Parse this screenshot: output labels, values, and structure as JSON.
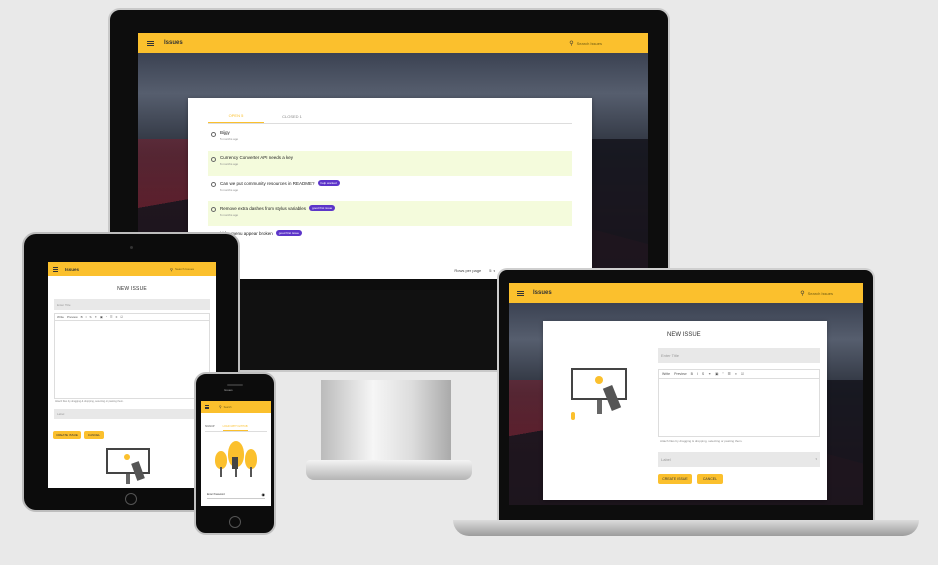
{
  "desktop": {
    "app_title": "Issues",
    "search_placeholder": "Search Issues",
    "tabs": [
      "OPEN 5",
      "CLOSED 1"
    ],
    "issues": [
      {
        "title": "Bijgy",
        "time": "5 months ago",
        "label": "",
        "highlight": false
      },
      {
        "title": "Currency Converter API needs a key",
        "time": "6 months ago",
        "label": "",
        "highlight": true
      },
      {
        "title": "Can we put community resources in README?",
        "time": "6 months ago",
        "label": "help wanted",
        "highlight": false
      },
      {
        "title": "Remove extra dashes from stylus variables",
        "time": "6 months ago",
        "label": "good first issue",
        "highlight": true
      },
      {
        "title": "ld for menu appear broken",
        "time": "",
        "label": "good first issue",
        "highlight": false
      }
    ],
    "pagination": {
      "rows_label": "Rows per page",
      "rows_value": "5",
      "range": "1-5 of 6"
    }
  },
  "tablet": {
    "app_title": "Issues",
    "search_placeholder": "Search Issues",
    "form_title": "NEW ISSUE",
    "title_placeholder": "Enter Title",
    "toolbar": [
      "Write",
      "Preview",
      "B",
      "I",
      "S",
      "⚭",
      "▣",
      "”",
      "☰",
      "≡",
      "☑"
    ],
    "hint": "Attach files by dragging & dropping, selecting or pasting them.",
    "label_placeholder": "Label",
    "create_label": "CREATE ISSUE",
    "cancel_label": "CANCEL"
  },
  "phone": {
    "status": "Issues",
    "search_placeholder": "Search",
    "tabs": [
      "SIGNUP",
      "LOGIN WITH GITHUB"
    ],
    "password_label": "Enter Password"
  },
  "laptop": {
    "app_title": "Issues",
    "search_placeholder": "Search Issues",
    "form_title": "NEW ISSUE",
    "title_placeholder": "Enter Title",
    "toolbar": [
      "Write",
      "Preview",
      "B",
      "I",
      "S",
      "⚭",
      "▣",
      "”",
      "☰",
      "≡",
      "☑"
    ],
    "hint": "Attach files by dragging & dropping, selecting or pasting them.",
    "label_placeholder": "Label",
    "create_label": "CREATE ISSUE",
    "cancel_label": "CANCEL"
  },
  "colors": {
    "accent": "#fbc02d",
    "chip": "#5c35c9",
    "highlight_row": "#f4fbdc"
  }
}
